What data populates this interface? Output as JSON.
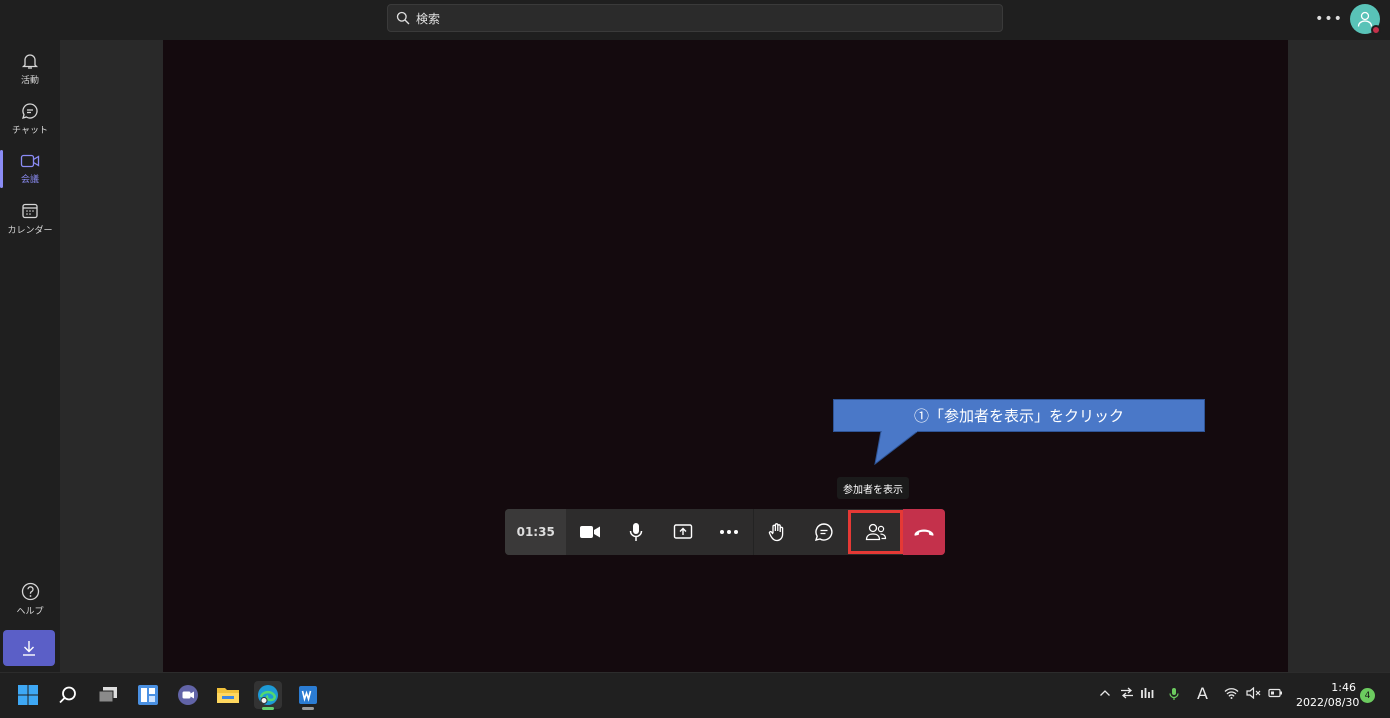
{
  "search": {
    "placeholder": "検索"
  },
  "rail": {
    "items": [
      {
        "label": "活動",
        "icon": "bell-icon"
      },
      {
        "label": "チャット",
        "icon": "chat-icon"
      },
      {
        "label": "会議",
        "icon": "video-icon"
      },
      {
        "label": "カレンダー",
        "icon": "calendar-icon"
      }
    ],
    "help": {
      "label": "ヘルプ",
      "icon": "help-icon"
    },
    "download_icon": "download-icon"
  },
  "callout": {
    "text": "①「参加者を表示」をクリック"
  },
  "tooltip": {
    "text": "参加者を表示"
  },
  "meeting_controls": {
    "timer": "01:35",
    "buttons": [
      "camera-icon",
      "microphone-icon",
      "share-screen-icon",
      "more-icon",
      "raise-hand-icon",
      "chat-icon",
      "participants-icon",
      "hangup-icon"
    ]
  },
  "taskbar": {
    "time": "1:46",
    "date": "2022/08/30",
    "notification_count": "4",
    "ime": "A"
  },
  "colors": {
    "accent": "#5b5fc7",
    "hangup": "#c4314b",
    "highlight": "#e53935",
    "callout": "#4a78c8"
  }
}
